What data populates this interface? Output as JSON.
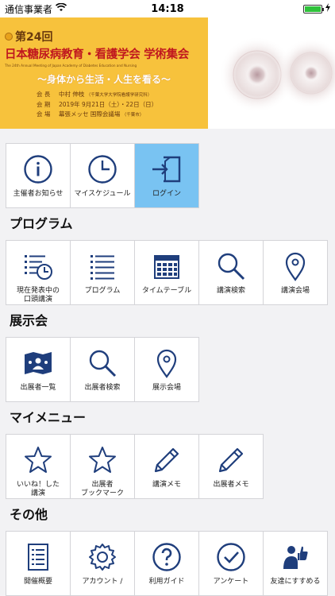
{
  "status": {
    "carrier": "通信事業者",
    "time": "14:18"
  },
  "banner": {
    "edition": "第24回",
    "title": "日本糖尿病教育・看護学会 学術集会",
    "title_en": "The 24th Annual Meeting of Japan Academy of Diabetes Education and Nursing",
    "theme": "～身体から生活・人生を看る～",
    "chair_key": "会 長",
    "chair_value": "中村 伸枝",
    "chair_note": "（千葉大学大学院看護学研究科）",
    "date_key": "会 期",
    "date_value": "2019年 9月21日（土）・22日（日）",
    "venue_key": "会 場",
    "venue_value": "幕張メッセ 国際会議場",
    "venue_note": "（千葉市）"
  },
  "top_tiles": [
    {
      "label": "主催者お知らせ",
      "icon": "info-icon"
    },
    {
      "label": "マイスケジュール",
      "icon": "clock-icon"
    },
    {
      "label": "ログイン",
      "icon": "login-icon"
    }
  ],
  "sections": {
    "program": {
      "title": "プログラム",
      "tiles": [
        {
          "label": "現在発表中の\n口頭講演",
          "icon": "list-clock-icon"
        },
        {
          "label": "プログラム",
          "icon": "list-icon"
        },
        {
          "label": "タイムテーブル",
          "icon": "calendar-icon"
        },
        {
          "label": "講演検索",
          "icon": "search-icon"
        },
        {
          "label": "講演会場",
          "icon": "location-pin-icon"
        }
      ]
    },
    "exhibition": {
      "title": "展示会",
      "tiles": [
        {
          "label": "出展者一覧",
          "icon": "booth-icon"
        },
        {
          "label": "出展者検索",
          "icon": "search-icon"
        },
        {
          "label": "展示会場",
          "icon": "location-pin-icon"
        }
      ]
    },
    "mymenu": {
      "title": "マイメニュー",
      "tiles": [
        {
          "label": "いいね！した\n講演",
          "icon": "star-icon"
        },
        {
          "label": "出展者\nブックマーク",
          "icon": "star-icon"
        },
        {
          "label": "講演メモ",
          "icon": "pencil-icon"
        },
        {
          "label": "出展者メモ",
          "icon": "pencil-icon"
        }
      ]
    },
    "other": {
      "title": "その他",
      "tiles": [
        {
          "label": "開催概要",
          "icon": "document-icon"
        },
        {
          "label": "アカウント /",
          "icon": "gear-icon"
        },
        {
          "label": "利用ガイド",
          "icon": "help-icon"
        },
        {
          "label": "アンケート",
          "icon": "check-circle-icon"
        },
        {
          "label": "友達にすすめる",
          "icon": "recommend-icon"
        }
      ]
    }
  },
  "colors": {
    "icon": "#1f3e7c",
    "login_bg": "#79c3f2",
    "banner_bg": "#f7c23c",
    "title_red": "#c0171f"
  }
}
